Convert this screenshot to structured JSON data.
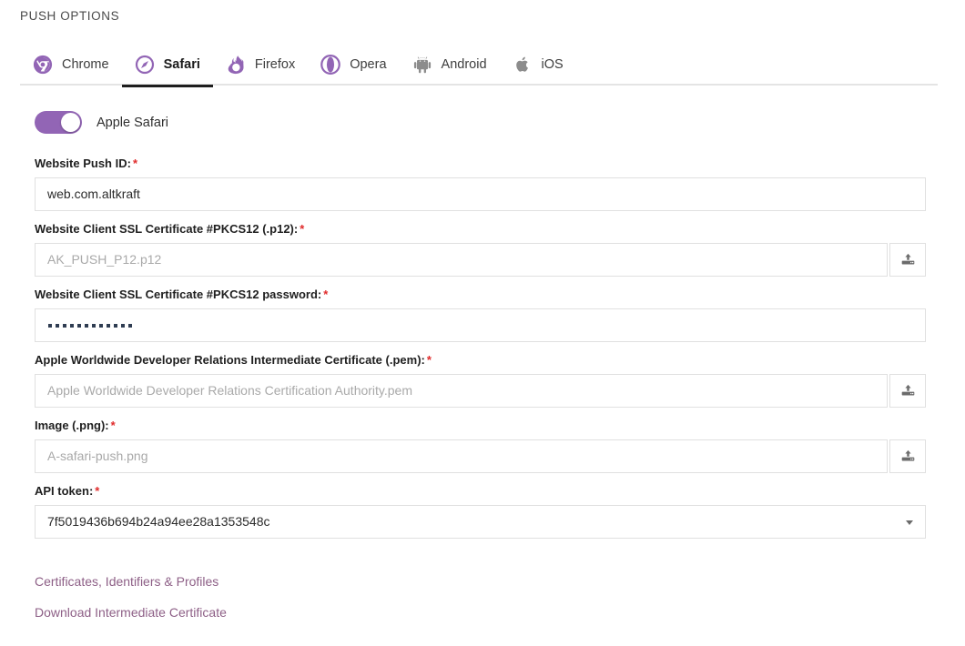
{
  "header": {
    "title": "PUSH OPTIONS"
  },
  "tabs": [
    {
      "id": "chrome",
      "label": "Chrome",
      "icon": "chrome-icon",
      "active": false,
      "state": "enabled"
    },
    {
      "id": "safari",
      "label": "Safari",
      "icon": "safari-icon",
      "active": true,
      "state": "enabled"
    },
    {
      "id": "firefox",
      "label": "Firefox",
      "icon": "firefox-icon",
      "active": false,
      "state": "enabled"
    },
    {
      "id": "opera",
      "label": "Opera",
      "icon": "opera-icon",
      "active": false,
      "state": "enabled"
    },
    {
      "id": "android",
      "label": "Android",
      "icon": "android-icon",
      "active": false,
      "state": "disabled"
    },
    {
      "id": "ios",
      "label": "iOS",
      "icon": "apple-icon",
      "active": false,
      "state": "disabled"
    }
  ],
  "toggle": {
    "label": "Apple Safari",
    "on": true
  },
  "fields": {
    "push_id": {
      "label": "Website Push ID:",
      "required": true,
      "value": "web.com.altkraft"
    },
    "p12": {
      "label": "Website Client SSL Certificate #PKCS12 (.p12):",
      "required": true,
      "placeholder": "AK_PUSH_P12.p12",
      "upload": true
    },
    "p12_password": {
      "label": "Website Client SSL Certificate #PKCS12 password:",
      "required": true,
      "masked_length": 12
    },
    "pem": {
      "label": "Apple Worldwide Developer Relations Intermediate Certificate (.pem):",
      "required": true,
      "placeholder": "Apple Worldwide Developer Relations Certification Authority.pem",
      "upload": true
    },
    "image": {
      "label": "Image (.png):",
      "required": true,
      "placeholder": "A-safari-push.png",
      "upload": true
    },
    "api_token": {
      "label": "API token:",
      "required": true,
      "value": "7f5019436b694b24a94ee28a1353548c",
      "dropdown": true
    }
  },
  "links": [
    {
      "label": "Certificates, Identifiers & Profiles"
    },
    {
      "label": "Download Intermediate Certificate"
    }
  ],
  "colors": {
    "accent_purple": "#9265b5",
    "link_purple": "#8d5f86",
    "required_red": "#e02b2b",
    "active_tab_underline": "#1e1e1e",
    "disabled_icon_gray": "#8c8c8c",
    "border": "#e0e0e0"
  },
  "icons": {
    "upload": "upload-icon",
    "caret": "chevron-down-icon"
  }
}
